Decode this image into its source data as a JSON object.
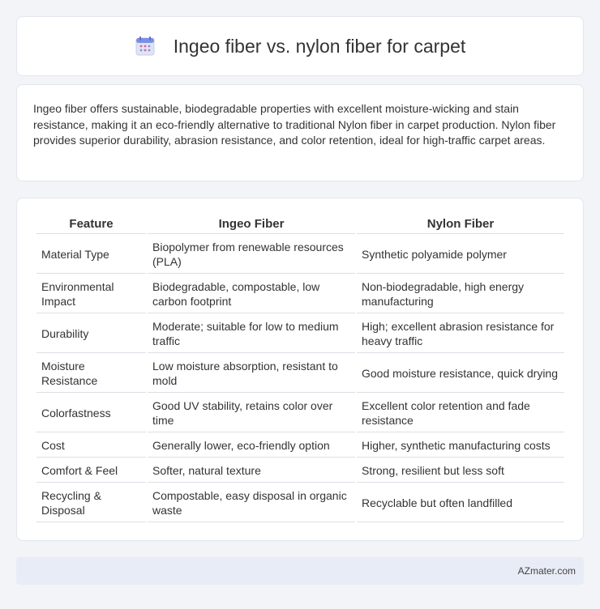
{
  "header": {
    "icon": "calendar-icon",
    "title": "Ingeo fiber vs. nylon fiber for carpet"
  },
  "summary": {
    "text": "Ingeo fiber offers sustainable, biodegradable properties with excellent moisture-wicking and stain resistance, making it an eco-friendly alternative to traditional Nylon fiber in carpet production. Nylon fiber provides superior durability, abrasion resistance, and color retention, ideal for high-traffic carpet areas."
  },
  "table": {
    "headers": [
      "Feature",
      "Ingeo Fiber",
      "Nylon Fiber"
    ],
    "rows": [
      [
        "Material Type",
        "Biopolymer from renewable resources (PLA)",
        "Synthetic polyamide polymer"
      ],
      [
        "Environmental Impact",
        "Biodegradable, compostable, low carbon footprint",
        "Non-biodegradable, high energy manufacturing"
      ],
      [
        "Durability",
        "Moderate; suitable for low to medium traffic",
        "High; excellent abrasion resistance for heavy traffic"
      ],
      [
        "Moisture Resistance",
        "Low moisture absorption, resistant to mold",
        "Good moisture resistance, quick drying"
      ],
      [
        "Colorfastness",
        "Good UV stability, retains color over time",
        "Excellent color retention and fade resistance"
      ],
      [
        "Cost",
        "Generally lower, eco-friendly option",
        "Higher, synthetic manufacturing costs"
      ],
      [
        "Comfort & Feel",
        "Softer, natural texture",
        "Strong, resilient but less soft"
      ],
      [
        "Recycling & Disposal",
        "Compostable, easy disposal in organic waste",
        "Recyclable but often landfilled"
      ]
    ]
  },
  "footer": {
    "brand": "AZmater.com"
  }
}
